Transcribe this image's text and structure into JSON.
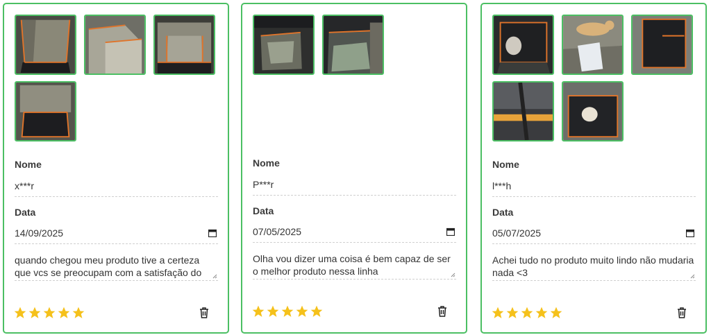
{
  "labels": {
    "name": "Nome",
    "date": "Data"
  },
  "colors": {
    "accent": "#4bbf63",
    "star": "#f5c11b"
  },
  "reviews": [
    {
      "photos": [
        "car-seat-cover-photo",
        "car-seat-cover-photo",
        "car-seat-cover-photo",
        "car-seat-cover-photo"
      ],
      "name": "x***r",
      "date": "14/09/2025",
      "comment": "quando chegou meu produto tive a certeza que vcs se preocupam com a satisfação do cliente",
      "rating": 5
    },
    {
      "photos": [
        "car-seat-cover-photo",
        "car-seat-cover-photo"
      ],
      "name": "P***r",
      "date": "07/05/2025",
      "comment": "Olha vou dizer uma coisa é bem capaz de ser o melhor produto nessa linha",
      "rating": 5
    },
    {
      "photos": [
        "car-seat-cover-photo",
        "dog-photo",
        "car-seat-cover-photo",
        "car-seat-cover-photo",
        "dog-in-car-photo"
      ],
      "name": "l***h",
      "date": "05/07/2025",
      "comment": "Achei tudo no produto muito lindo não mudaria nada <3",
      "rating": 5
    }
  ]
}
